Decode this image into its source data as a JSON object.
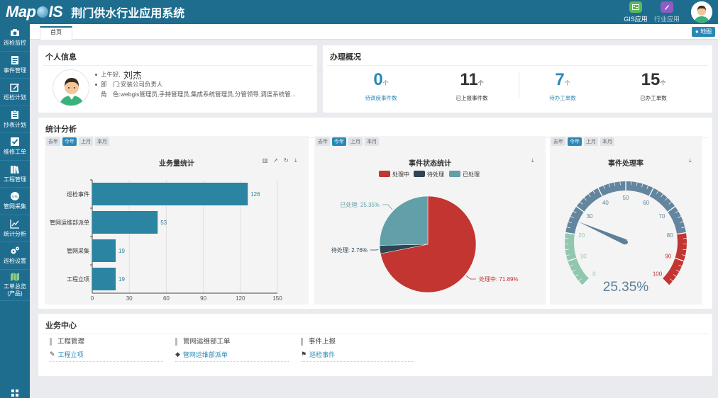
{
  "header": {
    "logo": "MapGIS",
    "title": "荆门供水行业应用系统",
    "buttons": [
      {
        "label": "GIS应用",
        "icon": "gis-app-icon"
      },
      {
        "label": "行业应用",
        "icon": "industry-app-icon"
      }
    ]
  },
  "sidebar": {
    "items": [
      {
        "label": "巡检监控",
        "icon": "camera-icon"
      },
      {
        "label": "事件管理",
        "icon": "event-log-icon"
      },
      {
        "label": "巡检计划",
        "icon": "edit-plan-icon"
      },
      {
        "label": "抄表计划",
        "icon": "clipboard-icon"
      },
      {
        "label": "维修工单",
        "icon": "checkbox-icon"
      },
      {
        "label": "工程管理",
        "icon": "books-icon"
      },
      {
        "label": "管网采集",
        "icon": "gis-collect-icon"
      },
      {
        "label": "统计分析",
        "icon": "line-chart-icon"
      },
      {
        "label": "巡检设置",
        "icon": "gears-icon"
      },
      {
        "label": "工单总览(产品)",
        "label1": "工单总览",
        "label2": "(产品)",
        "icon": "map-icon"
      }
    ]
  },
  "tabs": {
    "home": "首页",
    "map_button": "地图"
  },
  "personal": {
    "title": "个人信息",
    "greeting": "上午好,",
    "name": "刘杰",
    "dept": "部　门:安装公司负责人",
    "role": "角　色:webgis管理员,手持管理员,集成系统管理员,分管领导,调度系统管..."
  },
  "overview": {
    "title": "办理概况",
    "stats": [
      {
        "value": "0",
        "unit": "个",
        "label": "待调度事件数"
      },
      {
        "value": "11",
        "unit": "个",
        "label": "已上报事件数"
      },
      {
        "value": "7",
        "unit": "个",
        "label": "待办工单数"
      },
      {
        "value": "15",
        "unit": "个",
        "label": "已办工单数"
      }
    ]
  },
  "analysis": {
    "title": "统计分析",
    "periods": [
      "去年",
      "今年",
      "上月",
      "本月"
    ],
    "active_period": "今年"
  },
  "chart_data": [
    {
      "type": "bar",
      "orientation": "horizontal",
      "title": "业务量统计",
      "categories": [
        "巡检事件",
        "管网运维部派单",
        "管网采集",
        "工程立项"
      ],
      "values": [
        126,
        53,
        19,
        19
      ],
      "xlim": [
        0,
        150
      ],
      "xticks": [
        0,
        30,
        60,
        90,
        120,
        150
      ],
      "color": "#2a84a2",
      "grid": true
    },
    {
      "type": "pie",
      "title": "事件状态统计",
      "legend": [
        "处理中",
        "待处理",
        "已处理"
      ],
      "legend_position": "top",
      "slices": [
        {
          "name": "处理中",
          "value": 71.89,
          "label": "处理中: 71.89%",
          "color": "#c23531"
        },
        {
          "name": "待处理",
          "value": 2.76,
          "label": "待处理: 2.76%",
          "color": "#2f4554"
        },
        {
          "name": "已处理",
          "value": 25.35,
          "label": "已处理: 25.35%",
          "color": "#61a0a8"
        }
      ]
    },
    {
      "type": "gauge",
      "title": "事件处理率",
      "value": 25.35,
      "display": "25.35%",
      "min": 0,
      "max": 100,
      "ticks": [
        0,
        10,
        20,
        30,
        40,
        50,
        60,
        70,
        80,
        90,
        100
      ],
      "bands": [
        {
          "to": 20,
          "color": "#91c7ae"
        },
        {
          "to": 80,
          "color": "#63869e"
        },
        {
          "to": 100,
          "color": "#c23531"
        }
      ]
    }
  ],
  "business": {
    "title": "业务中心",
    "groups": [
      {
        "head": "工程管理",
        "link": "工程立项",
        "icon": "wrench-icon"
      },
      {
        "head": "管网运维部工单",
        "link": "管网运维部派单",
        "icon": "tags-icon"
      },
      {
        "head": "事件上报",
        "link": "巡检事件",
        "icon": "flag-icon"
      }
    ]
  }
}
